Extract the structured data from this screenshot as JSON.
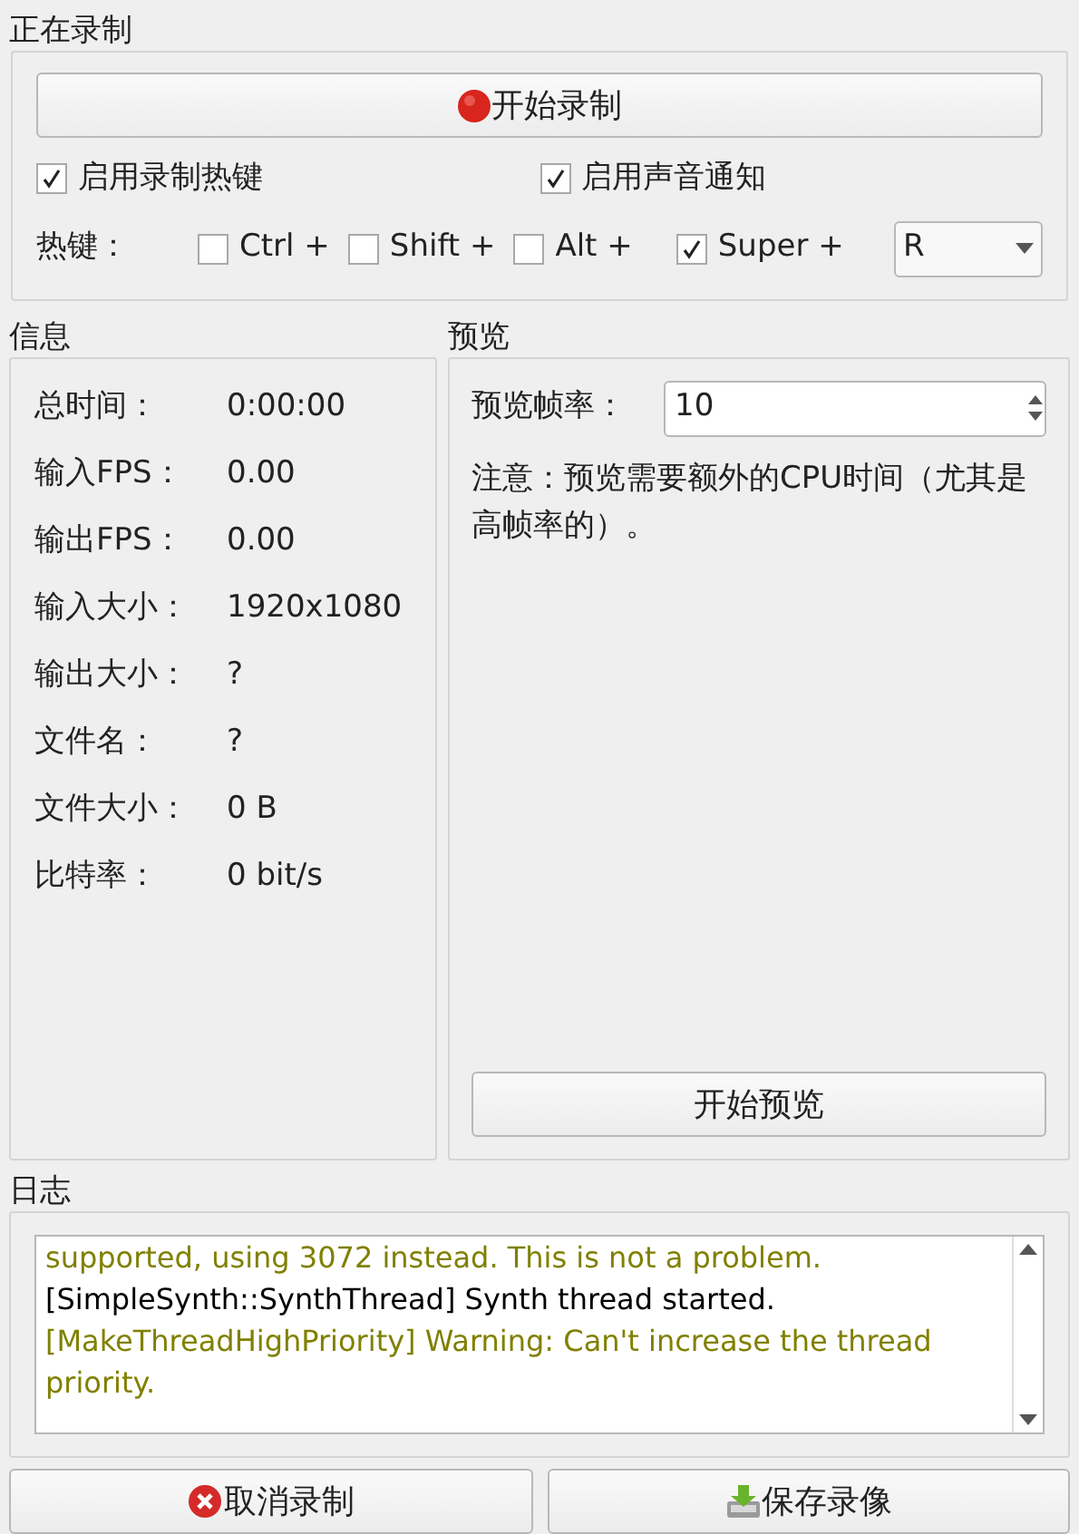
{
  "recording": {
    "title": "正在录制",
    "start_button": "开始录制",
    "options": [
      {
        "label": "启用录制热键",
        "checked": true
      },
      {
        "label": "启用声音通知",
        "checked": true
      }
    ],
    "hotkey_label": "热键：",
    "modifiers": [
      {
        "label": "Ctrl +",
        "checked": false
      },
      {
        "label": "Shift +",
        "checked": false
      },
      {
        "label": "Alt +",
        "checked": false
      },
      {
        "label": "Super +",
        "checked": true
      }
    ],
    "key": "R"
  },
  "info": {
    "title": "信息",
    "rows": [
      {
        "label": "总时间：",
        "value": "0:00:00"
      },
      {
        "label": "输入FPS：",
        "value": "0.00"
      },
      {
        "label": "输出FPS：",
        "value": "0.00"
      },
      {
        "label": "输入大小：",
        "value": "1920x1080"
      },
      {
        "label": "输出大小：",
        "value": "?"
      },
      {
        "label": "文件名：",
        "value": "?"
      },
      {
        "label": "文件大小：",
        "value": "0 B"
      },
      {
        "label": "比特率：",
        "value": "0 bit/s"
      }
    ]
  },
  "preview": {
    "title": "预览",
    "rate_label": "预览帧率：",
    "rate": "10",
    "note": "注意：预览需要额外的CPU时间（尤其是高帧率的）。",
    "button": "开始预览"
  },
  "log": {
    "title": "日志",
    "lines": [
      {
        "kind": "warning",
        "text": "supported, using 3072 instead. This is not a problem."
      },
      {
        "kind": "info",
        "text": "[SimpleSynth::SynthThread] Synth thread started."
      },
      {
        "kind": "warning",
        "text": "[MakeThreadHighPriority] Warning: Can't increase the thread priority."
      }
    ]
  },
  "buttons": [
    {
      "kind": "cancel",
      "label": "取消录制"
    },
    {
      "kind": "save",
      "label": "保存录像"
    }
  ]
}
